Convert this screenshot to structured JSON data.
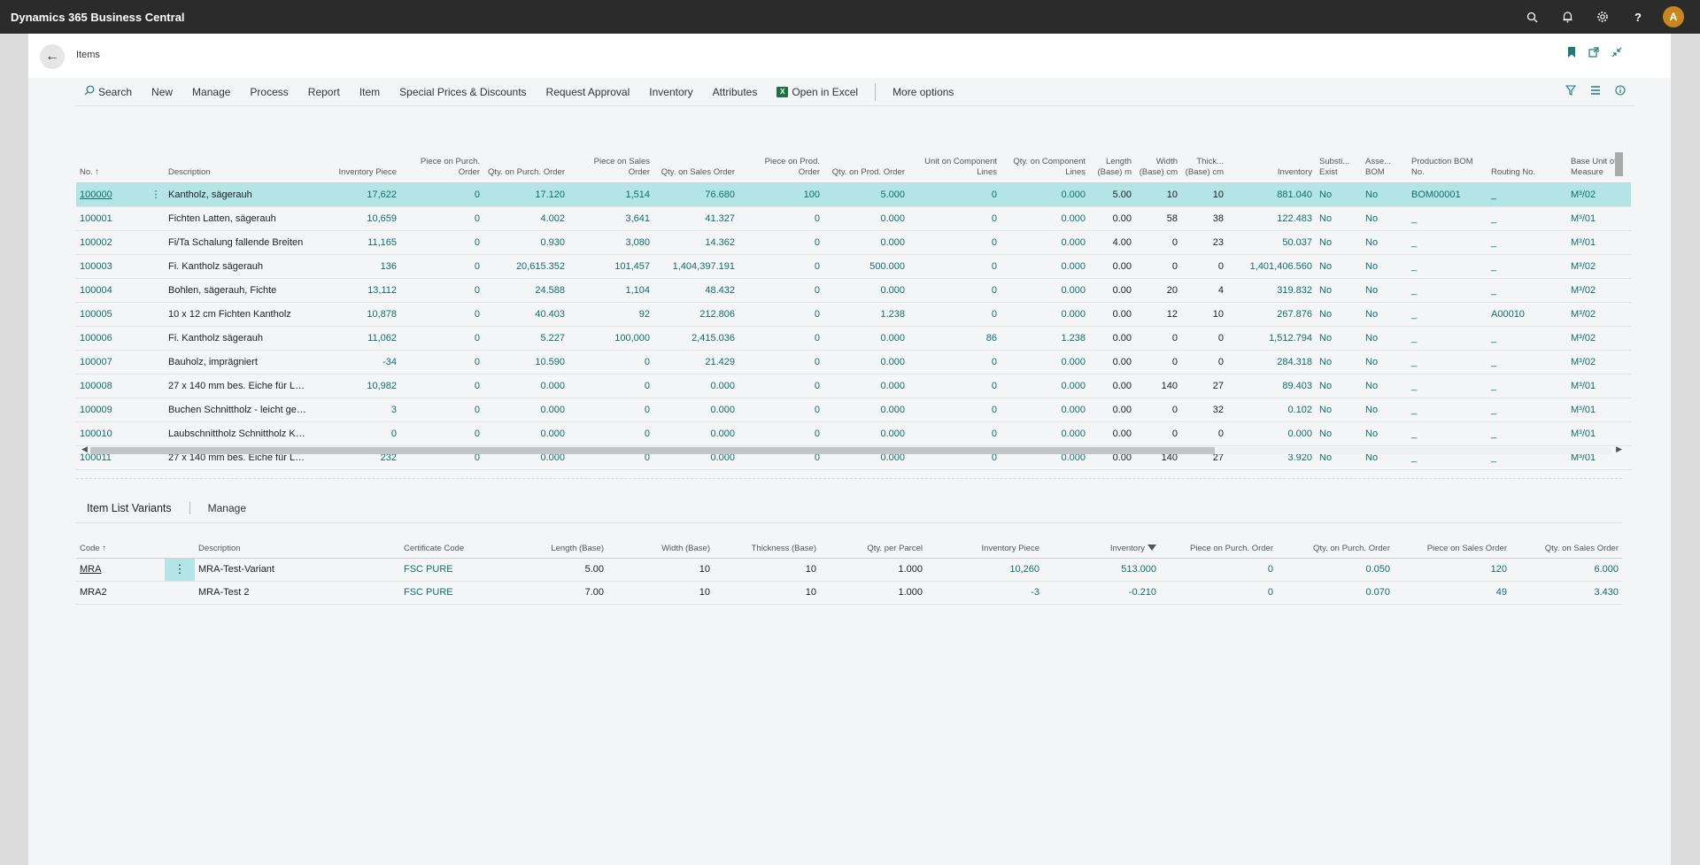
{
  "app": {
    "title": "Dynamics 365 Business Central",
    "avatar_initial": "A",
    "icons": [
      "search-icon",
      "bell-icon",
      "gear-icon",
      "help-icon"
    ]
  },
  "page": {
    "title": "Items",
    "back_icon": "arrow-left-icon",
    "header_icons": [
      "bookmark-icon",
      "open-new-window-icon",
      "collapse-icon"
    ]
  },
  "actions": {
    "search": "Search",
    "new": "New",
    "manage": "Manage",
    "process": "Process",
    "report": "Report",
    "item": "Item",
    "special_prices": "Special Prices & Discounts",
    "request_approval": "Request Approval",
    "inventory": "Inventory",
    "attributes": "Attributes",
    "open_in_excel": "Open in Excel",
    "more_options": "More options",
    "right_icons": [
      "filter-icon",
      "list-view-icon",
      "info-icon"
    ]
  },
  "items_table": {
    "columns": [
      "No. ↑",
      "",
      "Description",
      "Inventory Piece",
      "Piece on Purch. Order",
      "Qty. on Purch. Order",
      "Piece on Sales Order",
      "Qty. on Sales Order",
      "Piece on Prod. Order",
      "Qty. on Prod. Order",
      "Unit on Component Lines",
      "Qty. on Component Lines",
      "Length (Base) m",
      "Width (Base) cm",
      "Thick... (Base) cm",
      "Inventory",
      "Substi... Exist",
      "Asse... BOM",
      "Production BOM No.",
      "Routing No.",
      "Base Unit of Measure"
    ],
    "rows": [
      [
        "100000",
        "⋮",
        "Kantholz, sägerauh",
        "17,622",
        "0",
        "17.120",
        "1,514",
        "76.680",
        "100",
        "5.000",
        "0",
        "0.000",
        "5.00",
        "10",
        "10",
        "881.040",
        "No",
        "No",
        "BOM00001",
        "_",
        "M³/02"
      ],
      [
        "100001",
        "",
        "Fichten Latten, sägerauh",
        "10,659",
        "0",
        "4.002",
        "3,641",
        "41.327",
        "0",
        "0.000",
        "0",
        "0.000",
        "0.00",
        "58",
        "38",
        "122.483",
        "No",
        "No",
        "_",
        "_",
        "M³/01"
      ],
      [
        "100002",
        "",
        "Fi/Ta Schalung fallende Breiten",
        "11,165",
        "0",
        "0.930",
        "3,080",
        "14.362",
        "0",
        "0.000",
        "0",
        "0.000",
        "4.00",
        "0",
        "23",
        "50.037",
        "No",
        "No",
        "_",
        "_",
        "M³/01"
      ],
      [
        "100003",
        "",
        "Fi. Kantholz sägerauh",
        "136",
        "0",
        "20,615.352",
        "101,457",
        "1,404,397.191",
        "0",
        "500.000",
        "0",
        "0.000",
        "0.00",
        "0",
        "0",
        "1,401,406.560",
        "No",
        "No",
        "_",
        "_",
        "M³/02"
      ],
      [
        "100004",
        "",
        "Bohlen, sägerauh, Fichte",
        "13,112",
        "0",
        "24.588",
        "1,104",
        "48.432",
        "0",
        "0.000",
        "0",
        "0.000",
        "0.00",
        "20",
        "4",
        "319.832",
        "No",
        "No",
        "_",
        "_",
        "M³/02"
      ],
      [
        "100005",
        "",
        "10 x 12 cm Fichten Kantholz",
        "10,878",
        "0",
        "40.403",
        "92",
        "212.806",
        "0",
        "1.238",
        "0",
        "0.000",
        "0.00",
        "12",
        "10",
        "267.876",
        "No",
        "No",
        "_",
        "A00010",
        "M³/02"
      ],
      [
        "100006",
        "",
        "Fi. Kantholz sägerauh",
        "11,062",
        "0",
        "5.227",
        "100,000",
        "2,415.036",
        "0",
        "0.000",
        "86",
        "1.238",
        "0.00",
        "0",
        "0",
        "1,512.794",
        "No",
        "No",
        "_",
        "_",
        "M³/02"
      ],
      [
        "100007",
        "",
        "Bauholz, imprägniert",
        "-34",
        "0",
        "10.590",
        "0",
        "21.429",
        "0",
        "0.000",
        "0",
        "0.000",
        "0.00",
        "0",
        "0",
        "284.318",
        "No",
        "No",
        "_",
        "_",
        "M³/02"
      ],
      [
        "100008",
        "",
        "27 x 140 mm bes. Eiche für Lan...",
        "10,982",
        "0",
        "0.000",
        "0",
        "0.000",
        "0",
        "0.000",
        "0",
        "0.000",
        "0.00",
        "140",
        "27",
        "89.403",
        "No",
        "No",
        "_",
        "_",
        "M³/01"
      ],
      [
        "100009",
        "",
        "Buchen Schnittholz - leicht ged...",
        "3",
        "0",
        "0.000",
        "0",
        "0.000",
        "0",
        "0.000",
        "0",
        "0.000",
        "0.00",
        "0",
        "32",
        "0.102",
        "No",
        "No",
        "_",
        "_",
        "M³/01"
      ],
      [
        "100010",
        "",
        "Laubschnittholz Schnittholz KD...",
        "0",
        "0",
        "0.000",
        "0",
        "0.000",
        "0",
        "0.000",
        "0",
        "0.000",
        "0.00",
        "0",
        "0",
        "0.000",
        "No",
        "No",
        "_",
        "_",
        "M³/01"
      ],
      [
        "100011",
        "",
        "27 x 140 mm bes. Eiche für Lan...",
        "232",
        "0",
        "0.000",
        "0",
        "0.000",
        "0",
        "0.000",
        "0",
        "0.000",
        "0.00",
        "140",
        "27",
        "3.920",
        "No",
        "No",
        "_",
        "_",
        "M³/01"
      ]
    ]
  },
  "variants": {
    "title": "Item List Variants",
    "manage": "Manage",
    "columns": [
      "Code ↑",
      "",
      "Description",
      "Certificate Code",
      "Length (Base)",
      "Width (Base)",
      "Thickness (Base)",
      "Qty. per Parcel",
      "Inventory Piece",
      "Inventory",
      "Piece on Purch. Order",
      "Qty. on Purch. Order",
      "Piece on Sales Order",
      "Qty. on Sales Order"
    ],
    "rows": [
      [
        "MRA",
        "⋮",
        "MRA-Test-Variant",
        "FSC PURE",
        "5.00",
        "10",
        "10",
        "1.000",
        "10,260",
        "513.000",
        "0",
        "0.050",
        "120",
        "6.000"
      ],
      [
        "MRA2",
        "",
        "MRA-Test 2",
        "FSC PURE",
        "7.00",
        "10",
        "10",
        "1.000",
        "-3",
        "-0.210",
        "0",
        "0.070",
        "49",
        "3.430"
      ]
    ]
  },
  "colors": {
    "accent": "#0f6f6a",
    "selected_row": "#b3e5e6",
    "appbar": "#2b2b2b"
  }
}
